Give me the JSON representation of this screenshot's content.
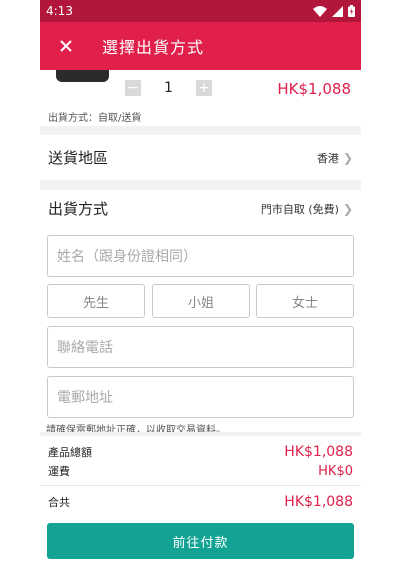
{
  "status_bar": {
    "time": "4:13"
  },
  "header": {
    "title": "選擇出貨方式"
  },
  "product": {
    "quantity": "1",
    "minus_symbol": "−",
    "plus_symbol": "+",
    "price": "HK$1,088",
    "shipping_note": "出貨方式：自取/送貨"
  },
  "region": {
    "label": "送貨地區",
    "value": "香港"
  },
  "shipping_method": {
    "label": "出貨方式",
    "value": "門市自取 (免費)"
  },
  "form": {
    "name_placeholder": "姓名（跟身份證相同）",
    "titles": [
      "先生",
      "小姐",
      "女士"
    ],
    "phone_placeholder": "聯絡電話",
    "email_placeholder": "電郵地址",
    "email_note": "請確保電郵地址正確，以收取交易資料。"
  },
  "summary": {
    "subtotal_label": "產品總額",
    "subtotal_value": "HK$1,088",
    "shipping_label": "運費",
    "shipping_value": "HK$0",
    "total_label": "合共",
    "total_value": "HK$1,088"
  },
  "pay_button": {
    "label": "前往付款"
  },
  "colors": {
    "header": "#e0204a",
    "status_bar": "#b2163a",
    "pay_button": "#12a394",
    "price": "#e0204a"
  }
}
